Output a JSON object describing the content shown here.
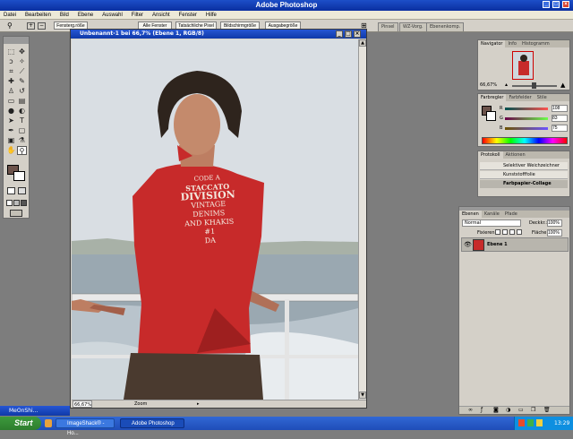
{
  "app": {
    "title": "Adobe Photoshop"
  },
  "menu": [
    "Datei",
    "Bearbeiten",
    "Bild",
    "Ebene",
    "Auswahl",
    "Filter",
    "Ansicht",
    "Fenster",
    "Hilfe"
  ],
  "options": {
    "buttons": [
      "Fensterg.röße",
      "Alle Fenster",
      "Tatsächliche Pixel",
      "Bildschirmgröße",
      "Ausgabegröße"
    ],
    "zoom_icon": "zoom-icon"
  },
  "palette_well_tabs": [
    "Pinsel",
    "WZ-Vorg.",
    "Ebenenkomp."
  ],
  "document": {
    "title": "Unbenannt-1 bei 66,7% (Ebene 1, RGB/8)",
    "zoom": "66,67%",
    "status_label": "Zoom",
    "shirt_text": [
      "CODE A",
      "STACCATO",
      "DIVISION",
      "VINTAGE",
      "DENIMS",
      "AND KHAKIS",
      "#1",
      "DA"
    ],
    "colors": {
      "shirt": "#c72a2a",
      "sky": "#d9dee3",
      "sea": "#9aa8b1",
      "hair": "#2e241d",
      "skin": "#bd7e62"
    }
  },
  "navigator": {
    "tabs": [
      "Navigator",
      "Info",
      "Histogramm"
    ],
    "zoom": "66,67%"
  },
  "colorpicker": {
    "tabs": [
      "Farbregler",
      "Farbfelder",
      "Stile"
    ],
    "channels": [
      {
        "label": "R",
        "value": "108"
      },
      {
        "label": "G",
        "value": "83"
      },
      {
        "label": "B",
        "value": "75"
      }
    ],
    "fg": "#6c534b"
  },
  "history": {
    "tabs": [
      "Protokoll",
      "Aktionen"
    ],
    "items": [
      "Selektiver Weichzeichner",
      "Kunststofffolie",
      "Farbpapier-Collage"
    ]
  },
  "layers": {
    "tabs": [
      "Ebenen",
      "Kanäle",
      "Pfade"
    ],
    "blend": "Normal",
    "opacity_label": "Deckkr.:",
    "opacity": "100%",
    "lock_label": "Fixieren:",
    "fill_label": "Fläche:",
    "fill": "100%",
    "items": [
      {
        "name": "Ebene 1"
      }
    ]
  },
  "mini_window": {
    "title": "MeOnShi..."
  },
  "taskbar": {
    "start": "Start",
    "tasks": [
      "ImageShack® - Ho...",
      "Adobe Photoshop"
    ],
    "clock": "13:29"
  }
}
